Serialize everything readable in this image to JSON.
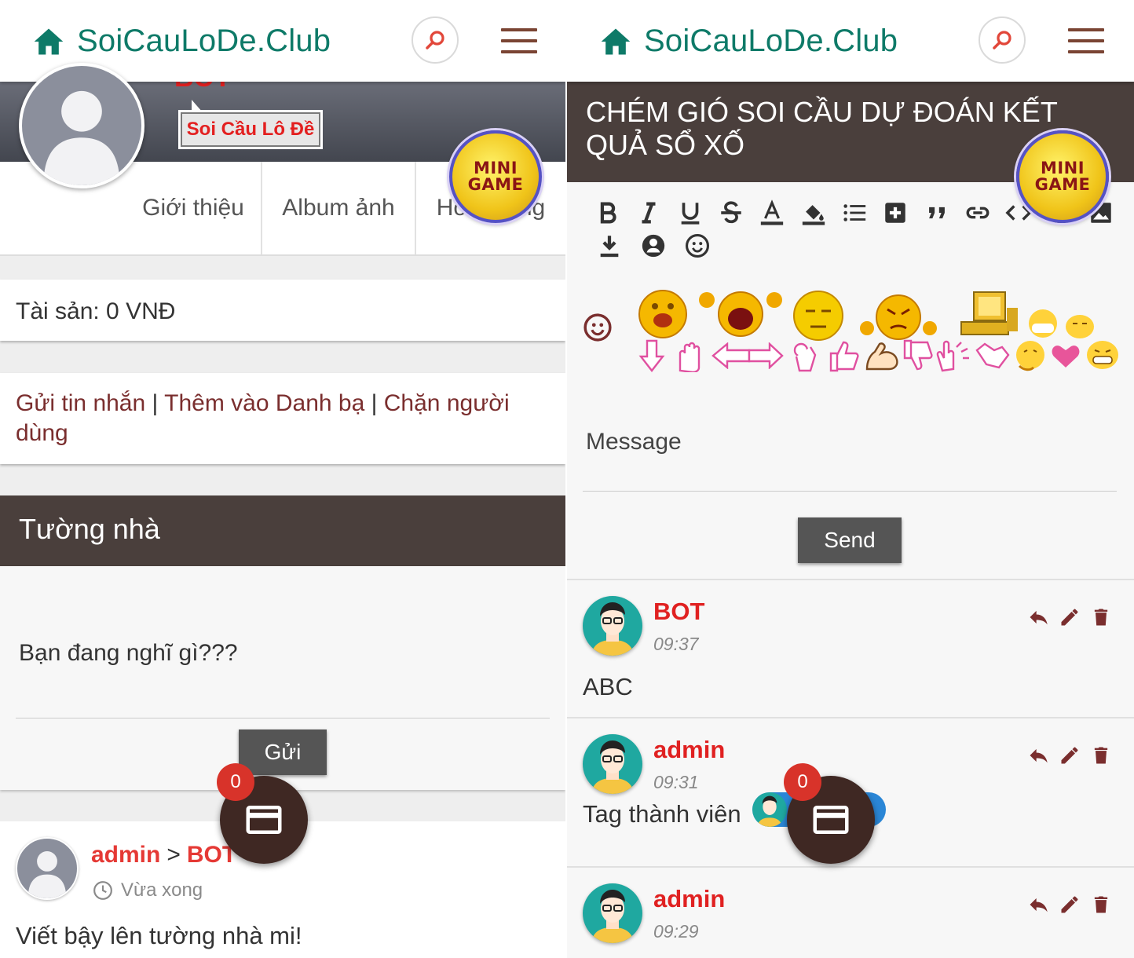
{
  "site": {
    "logo_text": "SoiCauLoDe.Club"
  },
  "colors": {
    "brand": "#0e7a68",
    "header_dark": "#4a3f3c",
    "name_red": "#e02121",
    "fab": "#3f2823",
    "badge_red": "#d8332a"
  },
  "left": {
    "profile": {
      "name": "BOT",
      "badge": "Soi Cầu Lô Đề"
    },
    "tabs": [
      {
        "label": "Giới thiệu"
      },
      {
        "label": "Album ảnh"
      },
      {
        "label": "Hoạt động"
      }
    ],
    "assets": "Tài sản: 0 VNĐ",
    "actions": {
      "send_message": "Gửi tin nhắn",
      "add_contact": "Thêm vào Danh bạ",
      "block_user": "Chặn người dùng",
      "separator": "|"
    },
    "wall": {
      "title": "Tường nhà",
      "placeholder": "Bạn đang nghĩ gì???",
      "submit": "Gửi"
    },
    "post": {
      "from": "admin",
      "arrow": ">",
      "to": "BOT",
      "time": "Vừa xong",
      "text": "Viết bậy lên tường nhà mi!"
    },
    "fab_count": "0"
  },
  "right": {
    "title": "CHÉM GIÓ SOI CẦU DỰ ĐOÁN KẾT QUẢ SỔ XỐ",
    "toolbar": [
      "bold-icon",
      "italic-icon",
      "underline-icon",
      "strikethrough-icon",
      "text-color-icon",
      "fill-color-icon",
      "list-icon",
      "plus-box-icon",
      "quote-icon",
      "link-icon",
      "code-icon",
      "emoji-icon",
      "image-icon",
      "download-icon",
      "user-icon",
      "smile-icon"
    ],
    "message_placeholder": "Message",
    "send": "Send",
    "messages": [
      {
        "name": "BOT",
        "time": "09:37",
        "text": "ABC"
      },
      {
        "name": "admin",
        "time": "09:31",
        "text": "Tag thành viên"
      },
      {
        "name": "admin",
        "time": "09:29",
        "text": ""
      }
    ],
    "fab_count": "0"
  },
  "mini_game": {
    "line1": "MINI",
    "line2": "GAME"
  }
}
